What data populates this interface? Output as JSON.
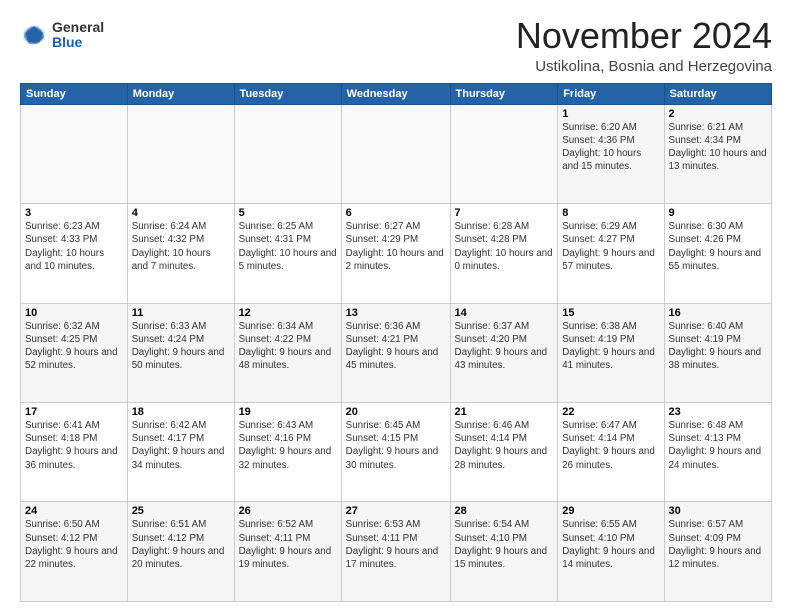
{
  "header": {
    "logo_general": "General",
    "logo_blue": "Blue",
    "month_title": "November 2024",
    "location": "Ustikolina, Bosnia and Herzegovina"
  },
  "weekdays": [
    "Sunday",
    "Monday",
    "Tuesday",
    "Wednesday",
    "Thursday",
    "Friday",
    "Saturday"
  ],
  "weeks": [
    [
      {
        "day": "",
        "info": ""
      },
      {
        "day": "",
        "info": ""
      },
      {
        "day": "",
        "info": ""
      },
      {
        "day": "",
        "info": ""
      },
      {
        "day": "",
        "info": ""
      },
      {
        "day": "1",
        "info": "Sunrise: 6:20 AM\nSunset: 4:36 PM\nDaylight: 10 hours and 15 minutes."
      },
      {
        "day": "2",
        "info": "Sunrise: 6:21 AM\nSunset: 4:34 PM\nDaylight: 10 hours and 13 minutes."
      }
    ],
    [
      {
        "day": "3",
        "info": "Sunrise: 6:23 AM\nSunset: 4:33 PM\nDaylight: 10 hours and 10 minutes."
      },
      {
        "day": "4",
        "info": "Sunrise: 6:24 AM\nSunset: 4:32 PM\nDaylight: 10 hours and 7 minutes."
      },
      {
        "day": "5",
        "info": "Sunrise: 6:25 AM\nSunset: 4:31 PM\nDaylight: 10 hours and 5 minutes."
      },
      {
        "day": "6",
        "info": "Sunrise: 6:27 AM\nSunset: 4:29 PM\nDaylight: 10 hours and 2 minutes."
      },
      {
        "day": "7",
        "info": "Sunrise: 6:28 AM\nSunset: 4:28 PM\nDaylight: 10 hours and 0 minutes."
      },
      {
        "day": "8",
        "info": "Sunrise: 6:29 AM\nSunset: 4:27 PM\nDaylight: 9 hours and 57 minutes."
      },
      {
        "day": "9",
        "info": "Sunrise: 6:30 AM\nSunset: 4:26 PM\nDaylight: 9 hours and 55 minutes."
      }
    ],
    [
      {
        "day": "10",
        "info": "Sunrise: 6:32 AM\nSunset: 4:25 PM\nDaylight: 9 hours and 52 minutes."
      },
      {
        "day": "11",
        "info": "Sunrise: 6:33 AM\nSunset: 4:24 PM\nDaylight: 9 hours and 50 minutes."
      },
      {
        "day": "12",
        "info": "Sunrise: 6:34 AM\nSunset: 4:22 PM\nDaylight: 9 hours and 48 minutes."
      },
      {
        "day": "13",
        "info": "Sunrise: 6:36 AM\nSunset: 4:21 PM\nDaylight: 9 hours and 45 minutes."
      },
      {
        "day": "14",
        "info": "Sunrise: 6:37 AM\nSunset: 4:20 PM\nDaylight: 9 hours and 43 minutes."
      },
      {
        "day": "15",
        "info": "Sunrise: 6:38 AM\nSunset: 4:19 PM\nDaylight: 9 hours and 41 minutes."
      },
      {
        "day": "16",
        "info": "Sunrise: 6:40 AM\nSunset: 4:19 PM\nDaylight: 9 hours and 38 minutes."
      }
    ],
    [
      {
        "day": "17",
        "info": "Sunrise: 6:41 AM\nSunset: 4:18 PM\nDaylight: 9 hours and 36 minutes."
      },
      {
        "day": "18",
        "info": "Sunrise: 6:42 AM\nSunset: 4:17 PM\nDaylight: 9 hours and 34 minutes."
      },
      {
        "day": "19",
        "info": "Sunrise: 6:43 AM\nSunset: 4:16 PM\nDaylight: 9 hours and 32 minutes."
      },
      {
        "day": "20",
        "info": "Sunrise: 6:45 AM\nSunset: 4:15 PM\nDaylight: 9 hours and 30 minutes."
      },
      {
        "day": "21",
        "info": "Sunrise: 6:46 AM\nSunset: 4:14 PM\nDaylight: 9 hours and 28 minutes."
      },
      {
        "day": "22",
        "info": "Sunrise: 6:47 AM\nSunset: 4:14 PM\nDaylight: 9 hours and 26 minutes."
      },
      {
        "day": "23",
        "info": "Sunrise: 6:48 AM\nSunset: 4:13 PM\nDaylight: 9 hours and 24 minutes."
      }
    ],
    [
      {
        "day": "24",
        "info": "Sunrise: 6:50 AM\nSunset: 4:12 PM\nDaylight: 9 hours and 22 minutes."
      },
      {
        "day": "25",
        "info": "Sunrise: 6:51 AM\nSunset: 4:12 PM\nDaylight: 9 hours and 20 minutes."
      },
      {
        "day": "26",
        "info": "Sunrise: 6:52 AM\nSunset: 4:11 PM\nDaylight: 9 hours and 19 minutes."
      },
      {
        "day": "27",
        "info": "Sunrise: 6:53 AM\nSunset: 4:11 PM\nDaylight: 9 hours and 17 minutes."
      },
      {
        "day": "28",
        "info": "Sunrise: 6:54 AM\nSunset: 4:10 PM\nDaylight: 9 hours and 15 minutes."
      },
      {
        "day": "29",
        "info": "Sunrise: 6:55 AM\nSunset: 4:10 PM\nDaylight: 9 hours and 14 minutes."
      },
      {
        "day": "30",
        "info": "Sunrise: 6:57 AM\nSunset: 4:09 PM\nDaylight: 9 hours and 12 minutes."
      }
    ]
  ]
}
